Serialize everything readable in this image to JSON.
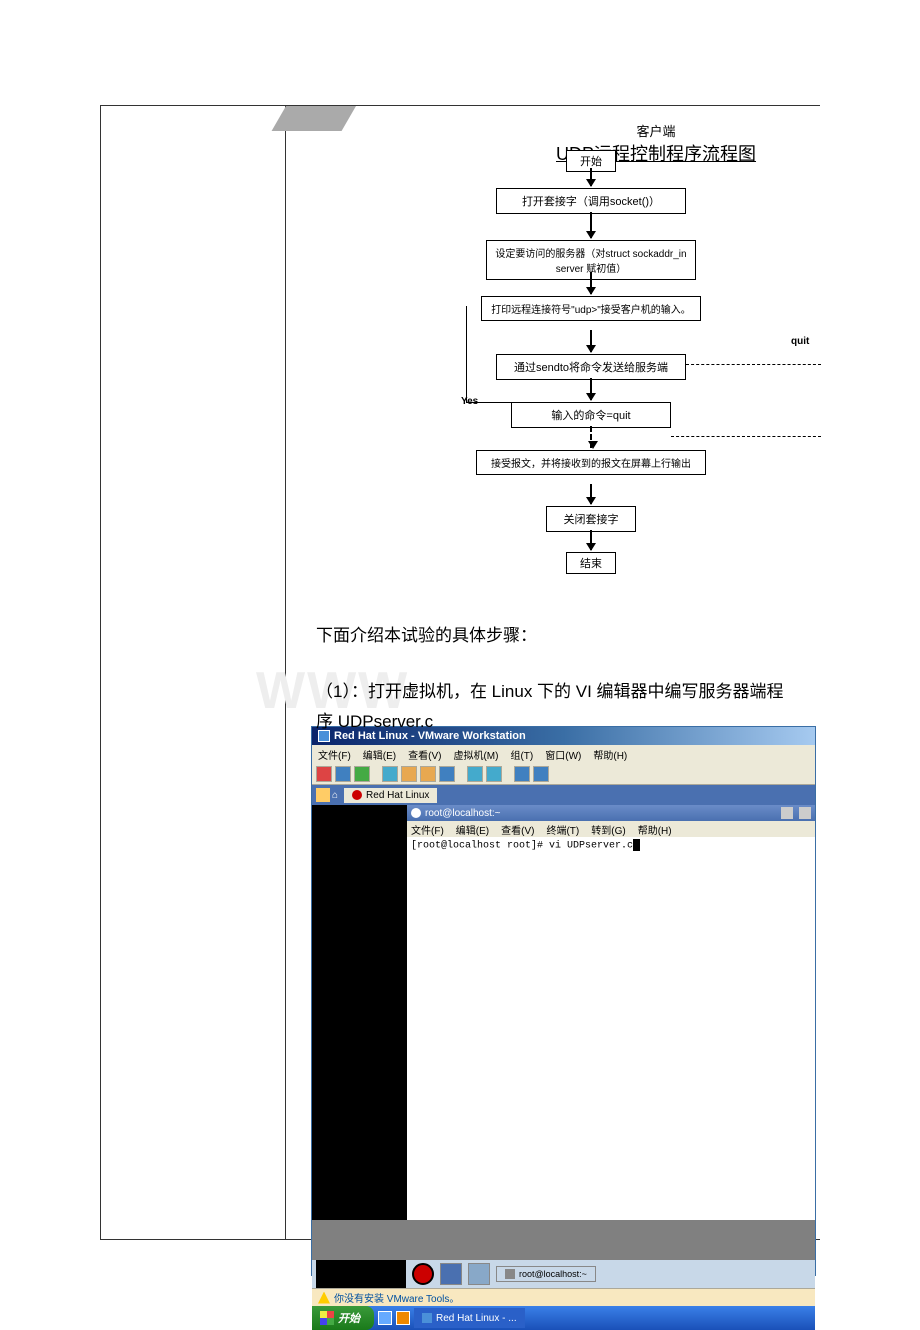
{
  "flowchart": {
    "supertitle": "客户端",
    "title": "UDP远程控制程序流程图",
    "box_start": "开始",
    "box_socket": "打开套接字（调用socket()）",
    "box_setserver": "设定要访问的服务器（对struct sockaddr_in server 赋初值）",
    "box_prompt": "打印远程连接符号\"udp>\"接受客户机的输入。",
    "box_sendto": "通过sendto将命令发送给服务端",
    "box_check": "输入的命令=quit",
    "box_recv": "接受报文，并将接收到的报文在屏幕上行输出",
    "box_close": "关闭套接字",
    "box_end": "结束",
    "label_yes": "Yes",
    "label_quit": "quit"
  },
  "text": {
    "intro": "下面介绍本试验的具体步骤：",
    "step1": "（1）：打开虚拟机，在 Linux 下的 VI 编辑器中编写服务器端程序 UDPserver.c"
  },
  "vmware": {
    "title": "Red Hat Linux - VMware Workstation",
    "menu": {
      "file": "文件(F)",
      "edit": "编辑(E)",
      "view": "查看(V)",
      "vm": "虚拟机(M)",
      "team": "组(T)",
      "window": "窗口(W)",
      "help": "帮助(H)"
    },
    "tab": "Red Hat Linux",
    "terminal": {
      "title": "root@localhost:~",
      "menu": {
        "file": "文件(F)",
        "edit": "编辑(E)",
        "view": "查看(V)",
        "terminal": "终端(T)",
        "goto": "转到(G)",
        "help": "帮助(H)"
      },
      "prompt": "[root@localhost root]# vi UDPserver.c"
    },
    "taskbar_item": "root@localhost:~",
    "warning": "你没有安装 VMware Tools。",
    "start": "开始",
    "wintask": "Red Hat Linux - ..."
  }
}
